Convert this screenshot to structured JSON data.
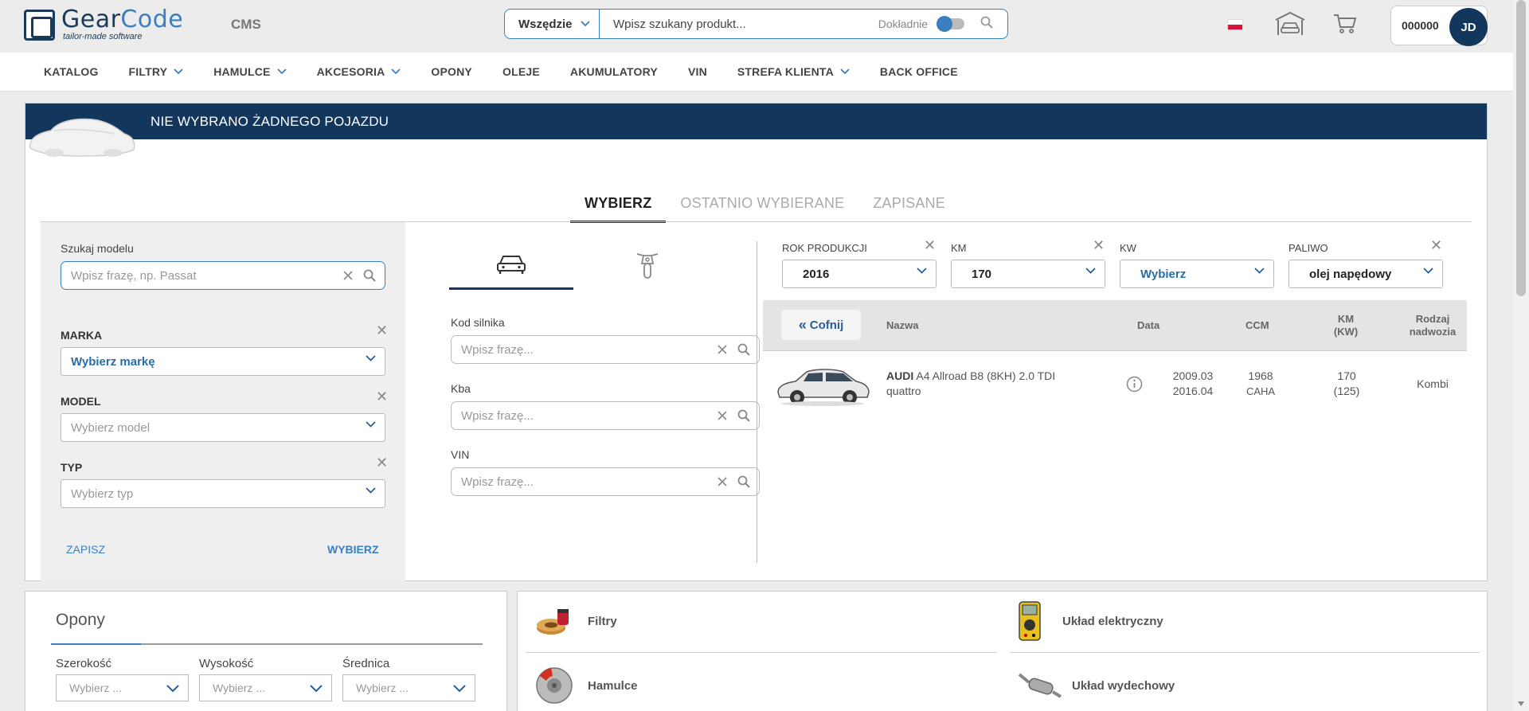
{
  "header": {
    "logo_name_a": "Gear",
    "logo_name_b": "Code",
    "logo_sub": "tailor-made software",
    "cms_label": "CMS",
    "search_scope": "Wszędzie",
    "search_placeholder": "Wpisz szukany produkt...",
    "exact_label": "Dokładnie",
    "account_number": "000000",
    "avatar_initials": "JD"
  },
  "nav": {
    "items": [
      {
        "label": "KATALOG",
        "dropdown": false
      },
      {
        "label": "FILTRY",
        "dropdown": true
      },
      {
        "label": "HAMULCE",
        "dropdown": true
      },
      {
        "label": "AKCESORIA",
        "dropdown": true
      },
      {
        "label": "OPONY",
        "dropdown": false
      },
      {
        "label": "OLEJE",
        "dropdown": false
      },
      {
        "label": "AKUMULATORY",
        "dropdown": false
      },
      {
        "label": "VIN",
        "dropdown": false
      },
      {
        "label": "STREFA KLIENTA",
        "dropdown": true
      },
      {
        "label": "BACK OFFICE",
        "dropdown": false
      }
    ]
  },
  "vehicle": {
    "header_title": "NIE WYBRANO ŻADNEGO POJAZDU",
    "tabs": [
      "WYBIERZ",
      "OSTATNIO WYBIERANE",
      "ZAPISANE"
    ],
    "search_model_label": "Szukaj modelu",
    "search_model_placeholder": "Wpisz frazę, np. Passat",
    "brand_label": "MARKA",
    "brand_value": "Wybierz markę",
    "model_label": "MODEL",
    "model_placeholder": "Wybierz model",
    "type_label": "TYP",
    "type_placeholder": "Wybierz typ",
    "save_link": "ZAPISZ",
    "choose_link": "WYBIERZ",
    "engine_code_label": "Kod silnika",
    "kba_label": "Kba",
    "vin_label": "VIN",
    "phrase_placeholder": "Wpisz frazę...",
    "filters": {
      "year_label": "ROK PRODUKCJI",
      "year_value": "2016",
      "km_label": "KM",
      "km_value": "170",
      "kw_label": "KW",
      "kw_value": "Wybierz",
      "fuel_label": "PALIWO",
      "fuel_value": "olej napędowy"
    },
    "results": {
      "back_label": "Cofnij",
      "columns": {
        "name": "Nazwa",
        "date": "Data",
        "ccm": "CCM",
        "km_a": "KM",
        "km_b": "(KW)",
        "body_a": "Rodzaj",
        "body_b": "nadwozia"
      },
      "rows": [
        {
          "brand": "AUDI",
          "model_a": "A4 Allroad B8 (8KH) 2.0 TDI",
          "model_b": "quattro",
          "date_from": "2009.03",
          "date_to": "2016.04",
          "ccm": "1968",
          "engine": "CAHA",
          "km": "170",
          "kw": "(125)",
          "body": "Kombi"
        }
      ]
    }
  },
  "tyres": {
    "title": "Opony",
    "width_label": "Szerokość",
    "height_label": "Wysokość",
    "diameter_label": "Średnica",
    "select_placeholder": "Wybierz ..."
  },
  "categories": [
    {
      "label": "Filtry"
    },
    {
      "label": "Układ elektryczny"
    },
    {
      "label": "Hamulce"
    },
    {
      "label": "Układ wydechowy"
    }
  ],
  "colors": {
    "brand_dark": "#13365d",
    "accent": "#3a7fc0"
  }
}
